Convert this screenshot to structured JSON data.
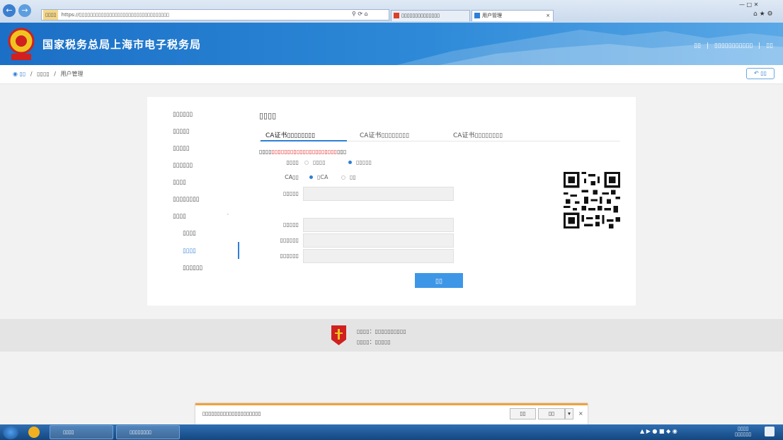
{
  "browser": {
    "address_url": "https://▯▯▯▯▯▯▯▯▯▯▯▯▯▯▯▯▯▯▯▯▯▯▯▯▯▯▯▯▯▯▯▯▯",
    "address_chip": "▯▯▯▯",
    "tabs": [
      {
        "label": "▯▯▯▯▯▯▯▯▯▯▯▯▯▯"
      },
      {
        "label": "用户管理"
      }
    ]
  },
  "header": {
    "site_title": "国家税务总局上海市电子税务局",
    "links": [
      "▯▯",
      "▯▯▯▯▯▯▯▯▯▯▯",
      "▯▯"
    ]
  },
  "breadcrumb": {
    "home": "▯▯",
    "items": [
      "▯▯▯▯",
      "用户管理"
    ],
    "back_label": "▯▯"
  },
  "sidebar": {
    "items": [
      {
        "label": "▯▯▯▯▯▯",
        "active": false
      },
      {
        "label": "▯▯▯▯▯",
        "active": false
      },
      {
        "label": "▯▯▯▯▯",
        "active": false
      },
      {
        "label": "▯▯▯▯▯▯",
        "active": false
      },
      {
        "label": "▯▯▯▯",
        "active": false
      },
      {
        "label": "▯▯▯▯▯▯▯▯",
        "active": false
      },
      {
        "label": "▯▯▯▯",
        "active": false
      },
      {
        "label": "▯▯▯▯",
        "active": false
      },
      {
        "label": "▯▯▯▯",
        "active": true
      },
      {
        "label": "▯▯▯▯▯▯",
        "active": false
      }
    ]
  },
  "main": {
    "title": "▯▯▯▯",
    "tabs": [
      {
        "label": "CA证书▯▯▯▯▯▯▯▯",
        "active": true
      },
      {
        "label": "CA证书▯▯▯▯▯▯▯▯",
        "active": false
      },
      {
        "label": "CA证书▯▯▯▯▯▯▯▯",
        "active": false
      }
    ],
    "notice_prefix": "▯▯▯▯",
    "notice_red": "▯▯▯▯▯▯▯▯▯▯▯▯▯▯▯▯▯▯▯▯▯",
    "notice_suffix": "▯▯▯",
    "form": {
      "cert_type_label": "▯▯▯▯",
      "cert_type_options": [
        "▯▯▯▯",
        "▯▯▯▯▯"
      ],
      "ca_label": "CA▯▯",
      "ca_options": [
        "▯CA",
        "▯▯"
      ],
      "field_labels": [
        "▯▯▯▯▯",
        "▯▯▯▯▯",
        "▯▯▯▯▯▯",
        "▯▯▯▯▯▯"
      ],
      "submit_label": "▯▯"
    }
  },
  "footer": {
    "line1": "▯▯▯▯：▯▯▯▯▯▯▯▯▯▯",
    "line2": "▯▯▯▯：▯▯▯▯▯"
  },
  "download_bar": {
    "message": "▯▯▯▯▯▯▯▯▯▯▯▯▯▯▯▯▯▯▯▯",
    "open_label": "▯▯",
    "save_label": "▯▯",
    "close_label": "×"
  },
  "taskbar": {
    "items": [
      "▯▯▯▯",
      "▯▯▯▯▯▯▯▯"
    ],
    "time": "▯▯▯▯",
    "date": "▯▯▯▯▯▯"
  },
  "colors": {
    "accent": "#2e7fd6",
    "header_blue": "#1b6fc6",
    "notice_red": "#e02020",
    "submit": "#3e97e6",
    "download_border": "#f0a13a"
  }
}
